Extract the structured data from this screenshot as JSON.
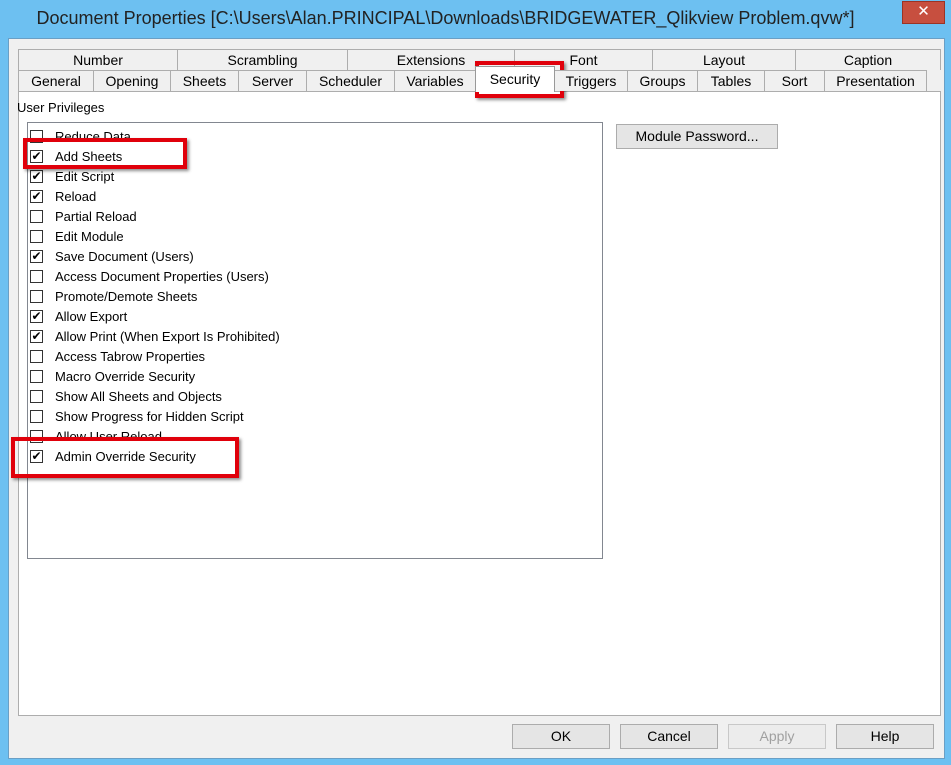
{
  "window": {
    "title": "Document Properties [C:\\Users\\Alan.PRINCIPAL\\Downloads\\BRIDGEWATER_Qlikview Problem.qvw*]",
    "close_glyph": "✕"
  },
  "tabs_row1": [
    "Number",
    "Scrambling",
    "Extensions",
    "Font",
    "Layout",
    "Caption"
  ],
  "tabs_row2": [
    "General",
    "Opening",
    "Sheets",
    "Server",
    "Scheduler",
    "Variables",
    "Security",
    "Triggers",
    "Groups",
    "Tables",
    "Sort",
    "Presentation"
  ],
  "active_tab": "Security",
  "security": {
    "group_label": "User Privileges",
    "module_password_label": "Module Password...",
    "privileges": [
      {
        "label": "Reduce Data",
        "checked": false
      },
      {
        "label": "Add Sheets",
        "checked": true
      },
      {
        "label": "Edit Script",
        "checked": true
      },
      {
        "label": "Reload",
        "checked": true
      },
      {
        "label": "Partial Reload",
        "checked": false
      },
      {
        "label": "Edit Module",
        "checked": false
      },
      {
        "label": "Save Document (Users)",
        "checked": true
      },
      {
        "label": "Access Document Properties (Users)",
        "checked": false
      },
      {
        "label": "Promote/Demote Sheets",
        "checked": false
      },
      {
        "label": "Allow Export",
        "checked": true
      },
      {
        "label": "Allow Print (When Export Is Prohibited)",
        "checked": true
      },
      {
        "label": "Access Tabrow Properties",
        "checked": false
      },
      {
        "label": "Macro Override Security",
        "checked": false
      },
      {
        "label": "Show All Sheets and Objects",
        "checked": false
      },
      {
        "label": "Show Progress for Hidden Script",
        "checked": false
      },
      {
        "label": "Allow User Reload",
        "checked": false
      },
      {
        "label": "Admin Override Security",
        "checked": true
      }
    ]
  },
  "footer": {
    "ok_label": "OK",
    "cancel_label": "Cancel",
    "apply_label": "Apply",
    "help_label": "Help"
  },
  "highlight_color": "#e0000b"
}
